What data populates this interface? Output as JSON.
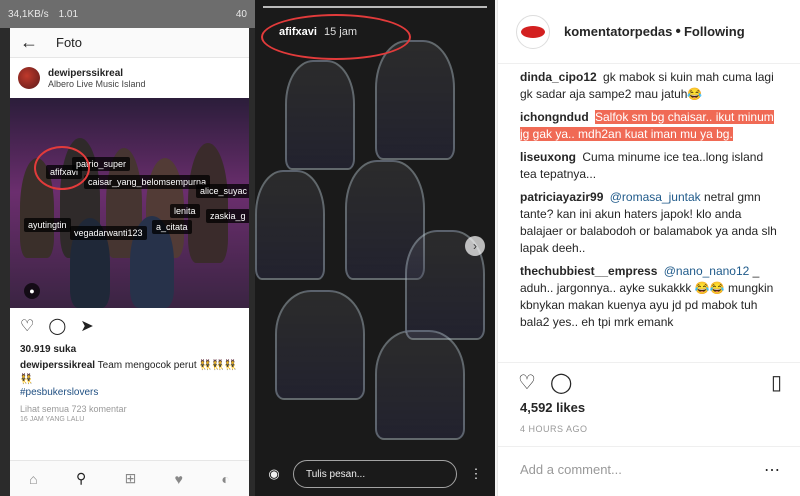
{
  "left_phone": {
    "status": {
      "left": "34,1KB/s",
      "time": "1.01",
      "right": "40"
    },
    "header": {
      "title": "Foto",
      "back_icon": "arrow-left-icon"
    },
    "post": {
      "username": "dewiperssikreal",
      "location": "Albero Live Music Island",
      "tags": [
        "afifxavi",
        "patrio_super",
        "caisar_yang_belomsempurna",
        "alice_suyac",
        "lenita",
        "zaskia_g",
        "ayutingtin",
        "vegadarwanti123",
        "a_citata"
      ],
      "likes": "30.919 suka",
      "caption_user": "dewiperssikreal",
      "caption_text": "Team mengocok perut 👯👯👯👯",
      "hashtag": "#pesbukerslovers",
      "view_all": "Lihat semua 723 komentar",
      "ago": "16 JAM YANG LALU"
    }
  },
  "story": {
    "username": "afifxavi",
    "time": "15 jam",
    "placeholder": "Tulis pesan..."
  },
  "panel": {
    "username": "komentatorpedas",
    "follow": "Following",
    "comments": [
      {
        "user": "dinda_cipo12",
        "text": "gk mabok si kuin mah cuma lagi gk sadar aja sampe2 mau jatuh😂"
      },
      {
        "user": "ichongndud",
        "text": "Salfok sm bg chaisar.. ikut minum jg gak ya.. mdh2an kuat iman mu ya bg."
      },
      {
        "user": "liseuxong",
        "text": "Cuma minume ice tea..long island tea tepatnya..."
      },
      {
        "user": "patriciayazir99",
        "mention": "@romasa_juntak",
        "text": "netral gmn tante? kan ini akun haters japok! klo anda balajaer or balabodoh or balamabok ya anda slh lapak deeh.."
      },
      {
        "user": "thechubbiest__empress",
        "mention": "@nano_nano12",
        "text": "_ aduh.. jargonnya.. ayke sukakkk 😂😂 mungkin kbnykan makan kuenya ayu jd pd mabok tuh bala2 yes.. eh tpi mrk emank"
      }
    ],
    "likes": "4,592 likes",
    "ago": "4 HOURS AGO",
    "add_comment": "Add a comment..."
  }
}
